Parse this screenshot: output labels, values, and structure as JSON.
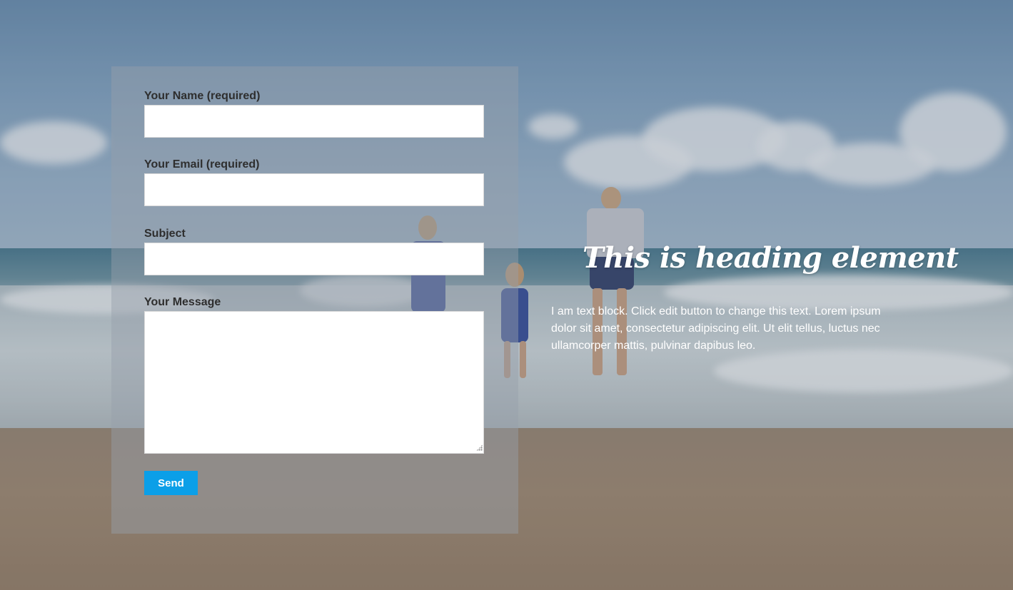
{
  "form": {
    "name_label": "Your Name (required)",
    "email_label": "Your Email (required)",
    "subject_label": "Subject",
    "message_label": "Your Message",
    "name_value": "",
    "email_value": "",
    "subject_value": "",
    "message_value": "",
    "send_label": "Send"
  },
  "content": {
    "heading": "This is heading element",
    "text": "I am text block. Click edit button to change this text. Lorem ipsum dolor sit amet, consectetur adipiscing elit. Ut elit tellus, luctus nec ullamcorper mattis, pulvinar dapibus leo."
  },
  "colors": {
    "button": "#0b9fe8",
    "label_text": "#2e2e2e",
    "heading_text": "#ffffff"
  }
}
